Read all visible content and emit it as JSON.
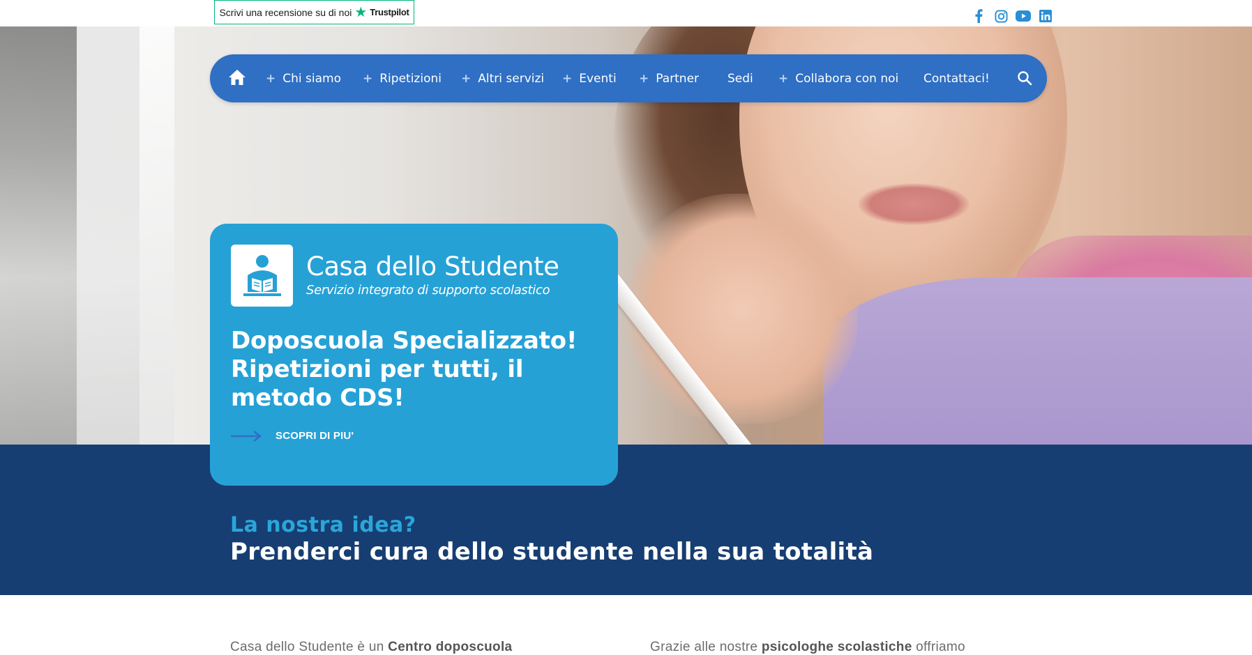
{
  "topbar": {
    "review_label": "Scrivi una recensione su di noi",
    "trustpilot_brand": "Trustpilot",
    "socials": [
      "facebook-icon",
      "instagram-icon",
      "youtube-icon",
      "linkedin-icon"
    ],
    "social_color": "#2a8ed6"
  },
  "nav": {
    "items": [
      {
        "label": "Chi siamo",
        "plus": "+"
      },
      {
        "label": "Ripetizioni",
        "plus": "+"
      },
      {
        "label": "Altri servizi",
        "plus": "+"
      },
      {
        "label": "Eventi",
        "plus": "+"
      },
      {
        "label": "Partner",
        "plus": "+"
      },
      {
        "label": "Sedi",
        "plus": ""
      },
      {
        "label": "Collabora con noi",
        "plus": "+"
      },
      {
        "label": "Contattaci!",
        "plus": ""
      }
    ],
    "background": "#2f6fc4"
  },
  "card": {
    "logo_title_light": "Casa dello ",
    "logo_title_bold": "Studente",
    "logo_subtitle": "Servizio integrato di supporto scolastico",
    "headline": "Doposcuola Specializzato! Ripetizioni per tutti, il metodo CDS!",
    "cta_label": "SCOPRI DI PIU'",
    "background": "#26a1d6"
  },
  "band": {
    "question": "La nostra idea?",
    "statement": "Prenderci cura dello studente nella sua totalità",
    "background": "#163e72",
    "accent": "#2aa6d9"
  },
  "content": {
    "col1_prefix": "Casa dello Studente è un ",
    "col1_bold": "Centro doposcuola",
    "col2_prefix": "Grazie alle nostre ",
    "col2_bold": "psicologhe scolastiche",
    "col2_suffix": " offriamo"
  }
}
